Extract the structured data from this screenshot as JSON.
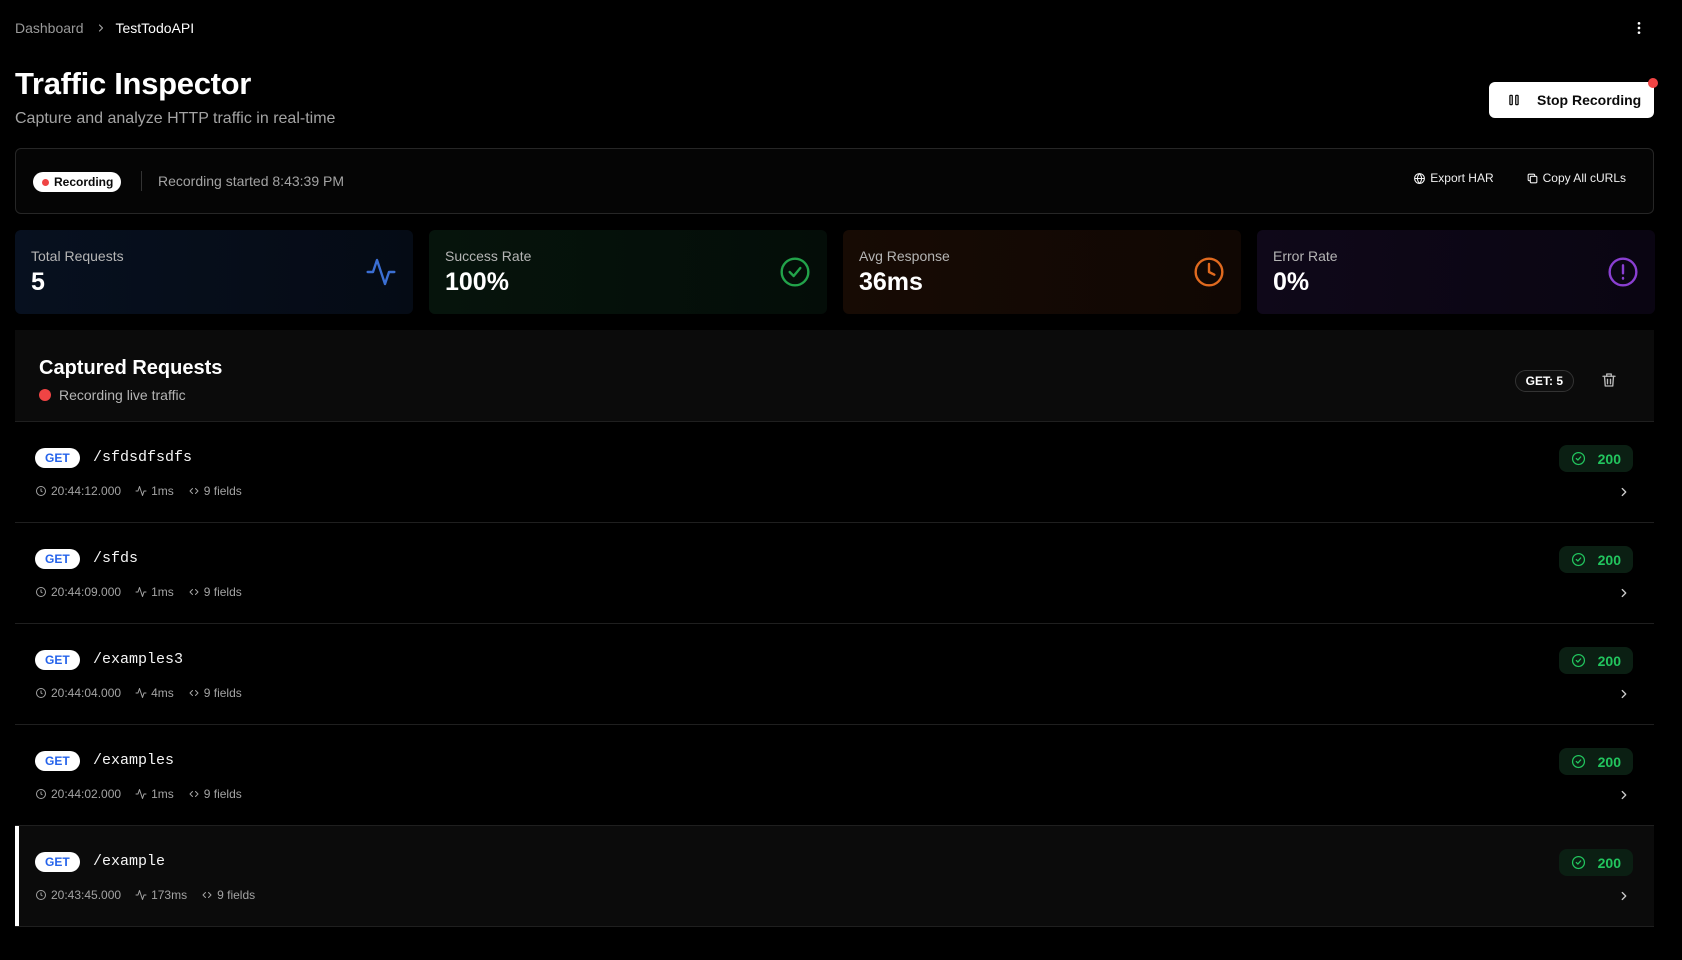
{
  "breadcrumb": {
    "root": "Dashboard",
    "current": "TestTodoAPI"
  },
  "header": {
    "title": "Traffic Inspector",
    "subtitle": "Capture and analyze HTTP traffic in real-time",
    "stop_button": "Stop Recording"
  },
  "recording": {
    "badge": "Recording",
    "started": "Recording started 8:43:39 PM",
    "export_har": "Export HAR",
    "copy_curls": "Copy All cURLs"
  },
  "stats": {
    "total_requests": {
      "label": "Total Requests",
      "value": "5",
      "color": "#3b6fd4",
      "icon": "activity-icon"
    },
    "success_rate": {
      "label": "Success Rate",
      "value": "100%",
      "color": "#22a34a",
      "icon": "check-circle-icon"
    },
    "avg_response": {
      "label": "Avg Response",
      "value": "36ms",
      "color": "#e06a1f",
      "icon": "clock-icon"
    },
    "error_rate": {
      "label": "Error Rate",
      "value": "0%",
      "color": "#8a3fd1",
      "icon": "alert-circle-icon"
    }
  },
  "captured": {
    "title": "Captured Requests",
    "live_label": "Recording live traffic",
    "method_count": "GET: 5"
  },
  "requests": [
    {
      "method": "GET",
      "path": "/sfdsdfsdfs",
      "time": "20:44:12.000",
      "duration": "1ms",
      "fields": "9 fields",
      "status": "200"
    },
    {
      "method": "GET",
      "path": "/sfds",
      "time": "20:44:09.000",
      "duration": "1ms",
      "fields": "9 fields",
      "status": "200"
    },
    {
      "method": "GET",
      "path": "/examples3",
      "time": "20:44:04.000",
      "duration": "4ms",
      "fields": "9 fields",
      "status": "200"
    },
    {
      "method": "GET",
      "path": "/examples",
      "time": "20:44:02.000",
      "duration": "1ms",
      "fields": "9 fields",
      "status": "200"
    },
    {
      "method": "GET",
      "path": "/example",
      "time": "20:43:45.000",
      "duration": "173ms",
      "fields": "9 fields",
      "status": "200"
    }
  ],
  "colors": {
    "recording_red": "#ef4444",
    "method_blue": "#2563eb",
    "status_green": "#22c55e"
  }
}
